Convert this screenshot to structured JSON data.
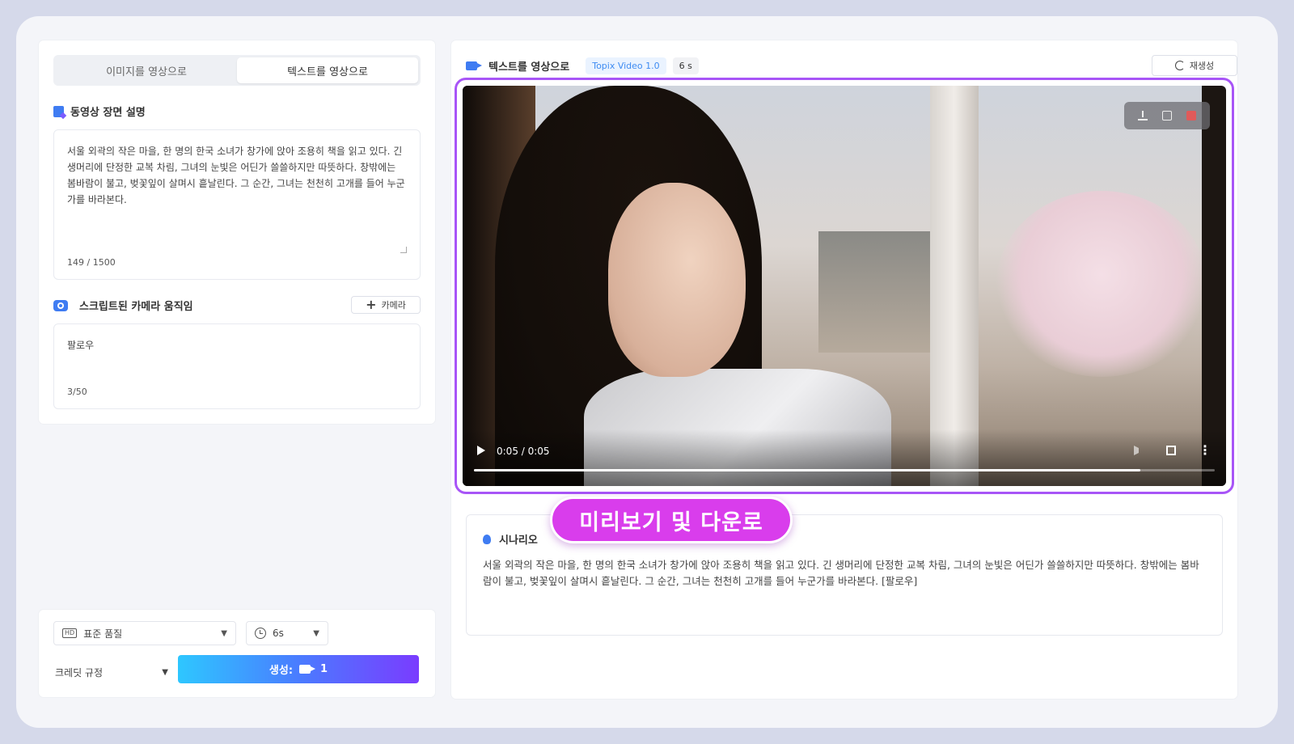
{
  "tabs": [
    {
      "label": "이미지를 영상으로",
      "active": false
    },
    {
      "label": "텍스트를 영상으로",
      "active": true
    }
  ],
  "scene": {
    "title": "동영상 장면 설명",
    "text": "서울 외곽의 작은 마을, 한 명의 한국 소녀가 창가에 앉아 조용히 책을 읽고 있다. 긴 생머리에 단정한 교복 차림, 그녀의 눈빛은 어딘가 쓸쓸하지만 따뜻하다. 창밖에는 봄바람이 불고, 벚꽃잎이 살며시 흩날린다. 그 순간, 그녀는 천천히 고개를 들어 누군가를 바라본다.",
    "counter": "149 / 1500"
  },
  "camera": {
    "title": "스크립트된 카메라 움직임",
    "add_label": "카메라",
    "value": "팔로우",
    "counter": "3/50"
  },
  "settings": {
    "quality": "표준 품질",
    "duration": "6s",
    "credit_label": "크레딧 규정",
    "generate_label": "생성:",
    "generate_cost": "1"
  },
  "output": {
    "title": "텍스트를 영상으로",
    "model": "Topix Video 1.0",
    "duration": "6 s",
    "regen_label": "재생성",
    "time": "0:05 / 0:05",
    "progress": 0.9
  },
  "scenario": {
    "title": "시나리오",
    "text": "서울 외곽의 작은 마을, 한 명의 한국 소녀가 창가에 앉아 조용히 책을 읽고 있다. 긴 생머리에 단정한 교복 차림, 그녀의 눈빛은 어딘가 쓸쓸하지만 따뜻하다. 창밖에는 봄바람이 불고, 벚꽃잎이 살며시 흩날린다. 그 순간, 그녀는 천천히 고개를 들어 누군가를 바라본다. [팔로우]"
  },
  "callout": {
    "label": "미리보기 및 다운로"
  },
  "colors": {
    "accent": "#a855f7",
    "callout": "#d93dec",
    "primary": "#3f7cf2"
  }
}
